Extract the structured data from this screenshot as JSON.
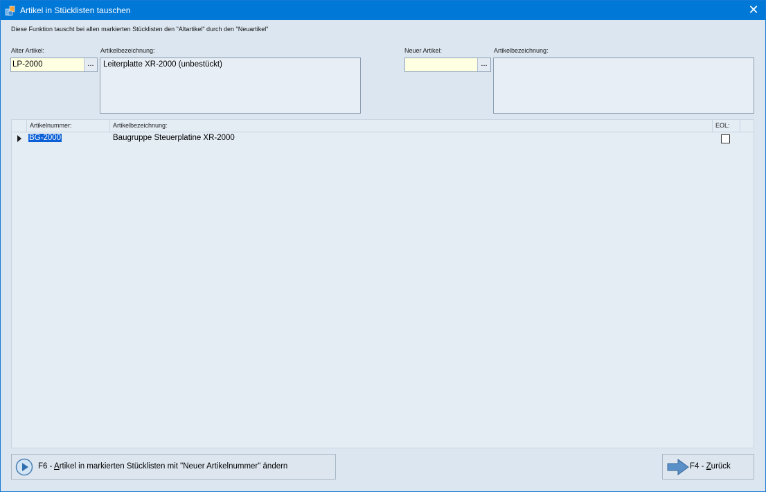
{
  "window": {
    "title": "Artikel in Stücklisten tauschen",
    "close_glyph": "✕"
  },
  "info_text": "Diese Funktion tauscht bei allen markierten Stücklisten den \"Altartikel\" durch den \"Neuartikel\"",
  "old_article": {
    "label": "Alter Artikel:",
    "value": "LP-2000",
    "lookup_glyph": "...",
    "desc_label": "Artikelbezeichnung:",
    "desc_value": "Leiterplatte XR-2000 (unbestückt)"
  },
  "new_article": {
    "label": "Neuer Artikel:",
    "value": "",
    "lookup_glyph": "...",
    "desc_label": "Artikelbezeichnung:",
    "desc_value": ""
  },
  "grid": {
    "columns": [
      "Artikelnummer:",
      "Artikelbezeichnung:",
      "EOL:"
    ],
    "rows": [
      {
        "article_no": "BG-2000",
        "description": "Baugruppe Steuerplatine XR-2000",
        "eol": false
      }
    ]
  },
  "buttons": {
    "change": {
      "prefix": "F6 - ",
      "mnemonic": "A",
      "rest": "rtikel in markierten Stücklisten mit \"Neuer Artikelnummer\"  ändern"
    },
    "back": {
      "prefix": "F4 - ",
      "mnemonic": "Z",
      "rest": "urück"
    }
  },
  "colors": {
    "titlebar": "#0078d7",
    "lookup_bg": "#ffffe1",
    "selection": "#0a5fd6",
    "form_bg": "#dce6f0"
  },
  "icons": [
    "app-icon",
    "close-icon",
    "lookup-ellipsis-icon",
    "row-indicator-icon",
    "play-icon",
    "arrow-right-icon"
  ]
}
